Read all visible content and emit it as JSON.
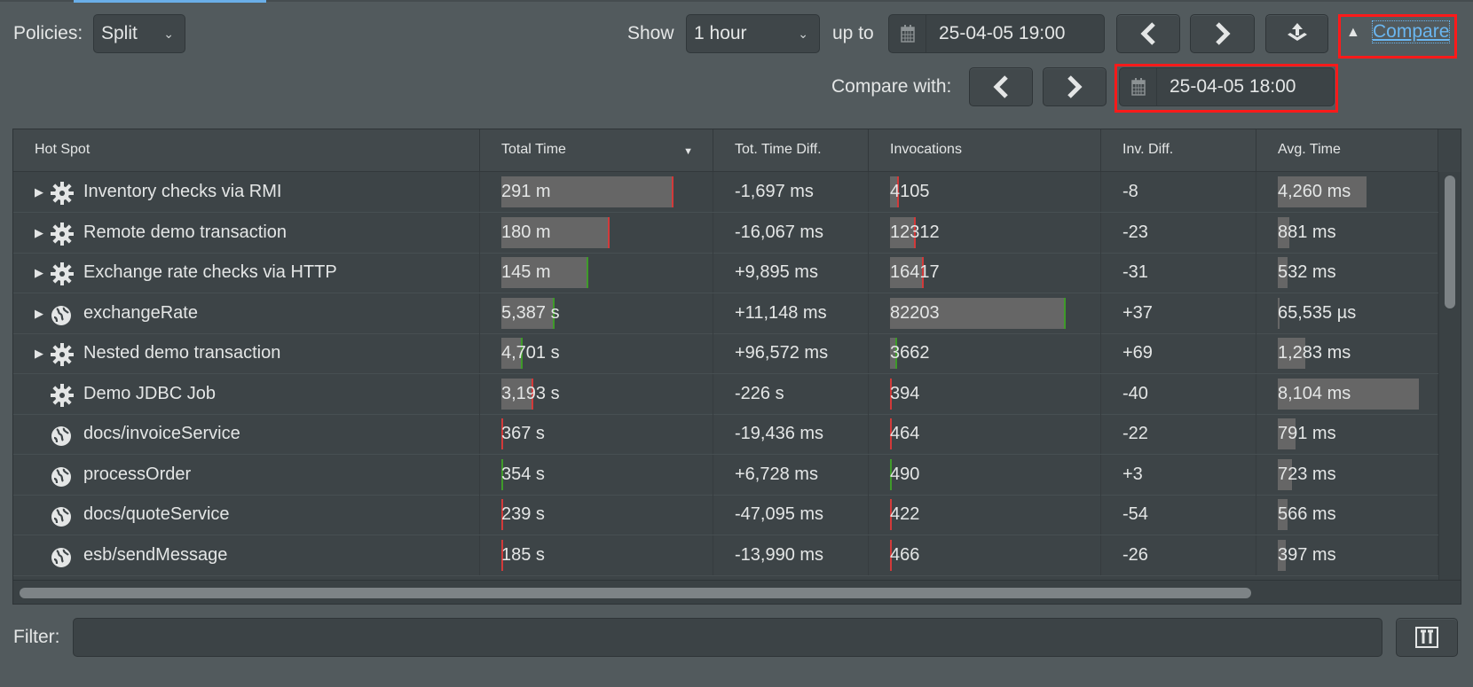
{
  "toolbar": {
    "policies_label": "Policies:",
    "policies_value": "Split",
    "show_label": "Show",
    "show_value": "1 hour",
    "upto_label": "up to",
    "date": "25-04-05 19:00",
    "compare_link": "Compare",
    "compare_with_label": "Compare with:",
    "compare_date": "25-04-05 18:00"
  },
  "table": {
    "headers": [
      "Hot Spot",
      "Total Time",
      "Tot. Time Diff.",
      "Invocations",
      "Inv. Diff.",
      "Avg. Time"
    ],
    "sorted_column": "Total Time",
    "rows": [
      {
        "icon": "gear",
        "expandable": true,
        "name": "Inventory checks via RMI",
        "total": "291 m",
        "total_bar": 0.81,
        "tdiff": "-1,697 ms",
        "inv": "4105",
        "inv_bar": 0.04,
        "idiff": "-8",
        "avg": "4,260 ms",
        "avg_bar": 0.55
      },
      {
        "icon": "gear",
        "expandable": true,
        "name": "Remote demo transaction",
        "total": "180 m",
        "total_bar": 0.51,
        "tdiff": "-16,067 ms",
        "inv": "12312",
        "inv_bar": 0.12,
        "idiff": "-23",
        "avg": "881 ms",
        "avg_bar": 0.07
      },
      {
        "icon": "gear",
        "expandable": true,
        "name": "Exchange rate checks via HTTP",
        "total": "145 m",
        "total_bar": 0.41,
        "tdiff": "+9,895 ms",
        "inv": "16417",
        "inv_bar": 0.16,
        "idiff": "-31",
        "avg": "532 ms",
        "avg_bar": 0.06
      },
      {
        "icon": "globe",
        "expandable": true,
        "name": "exchangeRate",
        "total": "5,387 s",
        "total_bar": 0.25,
        "tdiff": "+11,148 ms",
        "inv": "82203",
        "inv_bar": 0.83,
        "idiff": "+37",
        "avg": "65,535 µs",
        "avg_bar": 0.01
      },
      {
        "icon": "gear",
        "expandable": true,
        "name": "Nested demo transaction",
        "total": "4,701 s",
        "total_bar": 0.1,
        "tdiff": "+96,572 ms",
        "inv": "3662",
        "inv_bar": 0.035,
        "idiff": "+69",
        "avg": "1,283 ms",
        "avg_bar": 0.17
      },
      {
        "icon": "gear",
        "expandable": false,
        "name": "Demo JDBC Job",
        "total": "3,193 s",
        "total_bar": 0.15,
        "tdiff": "-226 s",
        "inv": "394",
        "inv_bar": 0.005,
        "idiff": "-40",
        "avg": "8,104 ms",
        "avg_bar": 0.88
      },
      {
        "icon": "globe",
        "expandable": false,
        "name": "docs/invoiceService",
        "total": "367 s",
        "total_bar": 0.01,
        "tdiff": "-19,436 ms",
        "inv": "464",
        "inv_bar": 0.005,
        "idiff": "-22",
        "avg": "791 ms",
        "avg_bar": 0.11
      },
      {
        "icon": "globe",
        "expandable": false,
        "name": "processOrder",
        "total": "354 s",
        "total_bar": 0.01,
        "tdiff": "+6,728 ms",
        "inv": "490",
        "inv_bar": 0.005,
        "idiff": "+3",
        "avg": "723 ms",
        "avg_bar": 0.09
      },
      {
        "icon": "globe",
        "expandable": false,
        "name": "docs/quoteService",
        "total": "239 s",
        "total_bar": 0.01,
        "tdiff": "-47,095 ms",
        "inv": "422",
        "inv_bar": 0.005,
        "idiff": "-54",
        "avg": "566 ms",
        "avg_bar": 0.06
      },
      {
        "icon": "globe",
        "expandable": false,
        "name": "esb/sendMessage",
        "total": "185 s",
        "total_bar": 0.01,
        "tdiff": "-13,990 ms",
        "inv": "466",
        "inv_bar": 0.005,
        "idiff": "-26",
        "avg": "397 ms",
        "avg_bar": 0.05
      }
    ]
  },
  "filter": {
    "label": "Filter:",
    "value": ""
  },
  "colors": {
    "increase": "#3f9a2a",
    "decrease": "#d23a3a",
    "link": "#6ab6f0",
    "highlight": "#ff1a1a"
  }
}
